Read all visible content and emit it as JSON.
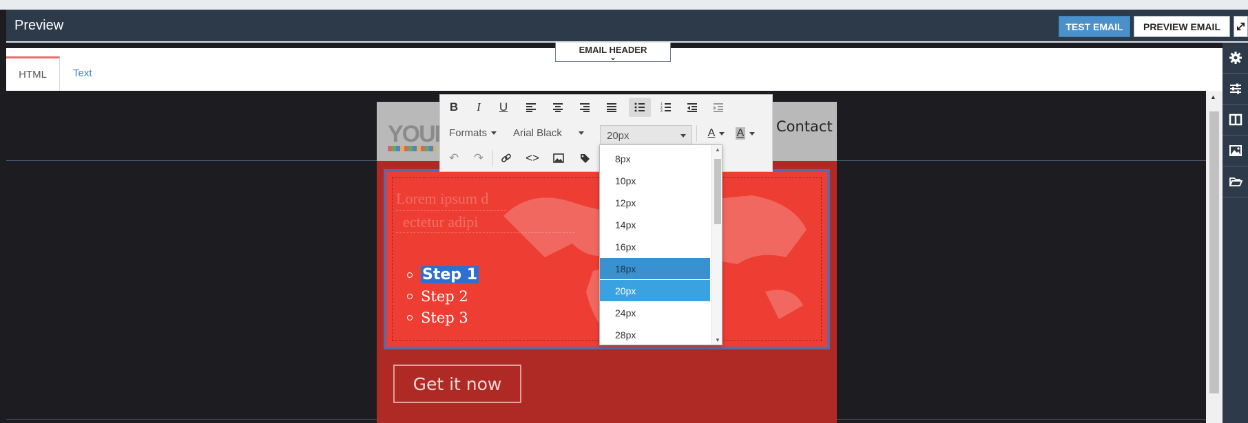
{
  "header": {
    "title": "Preview",
    "test_email_label": "TEST EMAIL",
    "preview_email_label": "PREVIEW EMAIL"
  },
  "tabs": {
    "html_label": "HTML",
    "text_label": "Text"
  },
  "email_header_tab": "EMAIL HEADER",
  "rail": [
    "gear-icon",
    "sliders-icon",
    "columns-icon",
    "image-icon",
    "folder-open-icon"
  ],
  "email": {
    "logo_text": "YOUR",
    "contact_label": "Contact",
    "ghost_line_1": "Lorem ipsum d",
    "ghost_line_2": "ectetur adipi",
    "steps": [
      "Step 1",
      "Step 2",
      "Step 3"
    ],
    "cta_label": "Get it now"
  },
  "toolbar": {
    "formats_label": "Formats",
    "font_label": "Arial Black",
    "size_label": "20px"
  },
  "font_size_options": [
    "8px",
    "10px",
    "12px",
    "14px",
    "16px",
    "18px",
    "20px",
    "24px",
    "28px"
  ],
  "font_size_hover": "18px",
  "font_size_selected": "20px",
  "colors": {
    "header_bg": "#2c3a4a",
    "accent_blue": "#4a90c9",
    "tab_active_border": "#e96b6b",
    "hero_red": "#ee3e33",
    "canvas_bg": "#1d1d21"
  }
}
